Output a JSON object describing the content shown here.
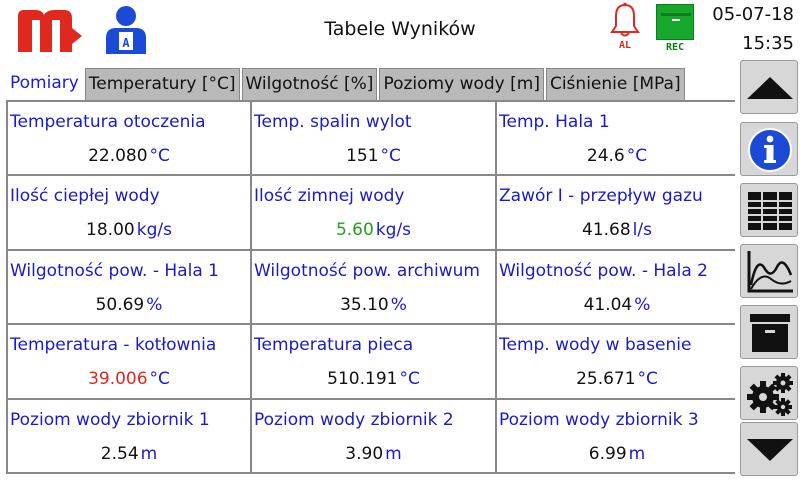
{
  "header": {
    "title": "Tabele Wyników",
    "date": "05-07-18",
    "time": "15:35",
    "alarm_label": "AL",
    "rec_label": "REC",
    "logo_icon": "brand-m-logo",
    "user_icon": "user-icon",
    "colors": {
      "logo": "#e0281e",
      "user": "#1a4ad6",
      "alarm": "#e0281e",
      "rec": "#16a82a"
    }
  },
  "tabs": [
    {
      "label": "Pomiary",
      "active": true
    },
    {
      "label": "Temperatury [°C]",
      "active": false
    },
    {
      "label": "Wilgotność [%]",
      "active": false
    },
    {
      "label": "Poziomy wody [m]",
      "active": false
    },
    {
      "label": "Ciśnienie [MPa]",
      "active": false
    }
  ],
  "cells": [
    {
      "label": "Temperatura otoczenia",
      "value": "22.080",
      "unit": "°C",
      "status": "normal"
    },
    {
      "label": "Temp. spalin wylot",
      "value": "151",
      "unit": "°C",
      "status": "normal"
    },
    {
      "label": "Temp. Hala 1",
      "value": "24.6",
      "unit": "°C",
      "status": "normal"
    },
    {
      "label": "Ilość ciepłej wody",
      "value": "18.00",
      "unit": "kg/s",
      "status": "normal"
    },
    {
      "label": "Ilość zimnej wody",
      "value": "5.60",
      "unit": "kg/s",
      "status": "low"
    },
    {
      "label": "Zawór I - przepływ gazu",
      "value": "41.68",
      "unit": "l/s",
      "status": "normal"
    },
    {
      "label": "Wilgotność pow. - Hala 1",
      "value": "50.69",
      "unit": "%",
      "status": "normal"
    },
    {
      "label": "Wilgotność pow. archiwum",
      "value": "35.10",
      "unit": "%",
      "status": "normal"
    },
    {
      "label": "Wilgotność pow. - Hala 2",
      "value": "41.04",
      "unit": "%",
      "status": "normal"
    },
    {
      "label": "Temperatura - kotłownia",
      "value": "39.006",
      "unit": "°C",
      "status": "alarm"
    },
    {
      "label": "Temperatura pieca",
      "value": "510.191",
      "unit": "°C",
      "status": "normal"
    },
    {
      "label": "Temp. wody w basenie",
      "value": "25.671",
      "unit": "°C",
      "status": "normal"
    },
    {
      "label": "Poziom wody zbiornik 1",
      "value": "2.54",
      "unit": "m",
      "status": "normal"
    },
    {
      "label": "Poziom wody zbiornik 2",
      "value": "3.90",
      "unit": "m",
      "status": "normal"
    },
    {
      "label": "Poziom wody zbiornik 3",
      "value": "6.99",
      "unit": "m",
      "status": "normal"
    }
  ],
  "side_buttons": [
    {
      "icon": "arrow-up-icon"
    },
    {
      "icon": "info-icon"
    },
    {
      "icon": "table-icon"
    },
    {
      "icon": "chart-icon"
    },
    {
      "icon": "archive-icon"
    },
    {
      "icon": "settings-gears-icon"
    },
    {
      "icon": "arrow-down-icon"
    }
  ]
}
